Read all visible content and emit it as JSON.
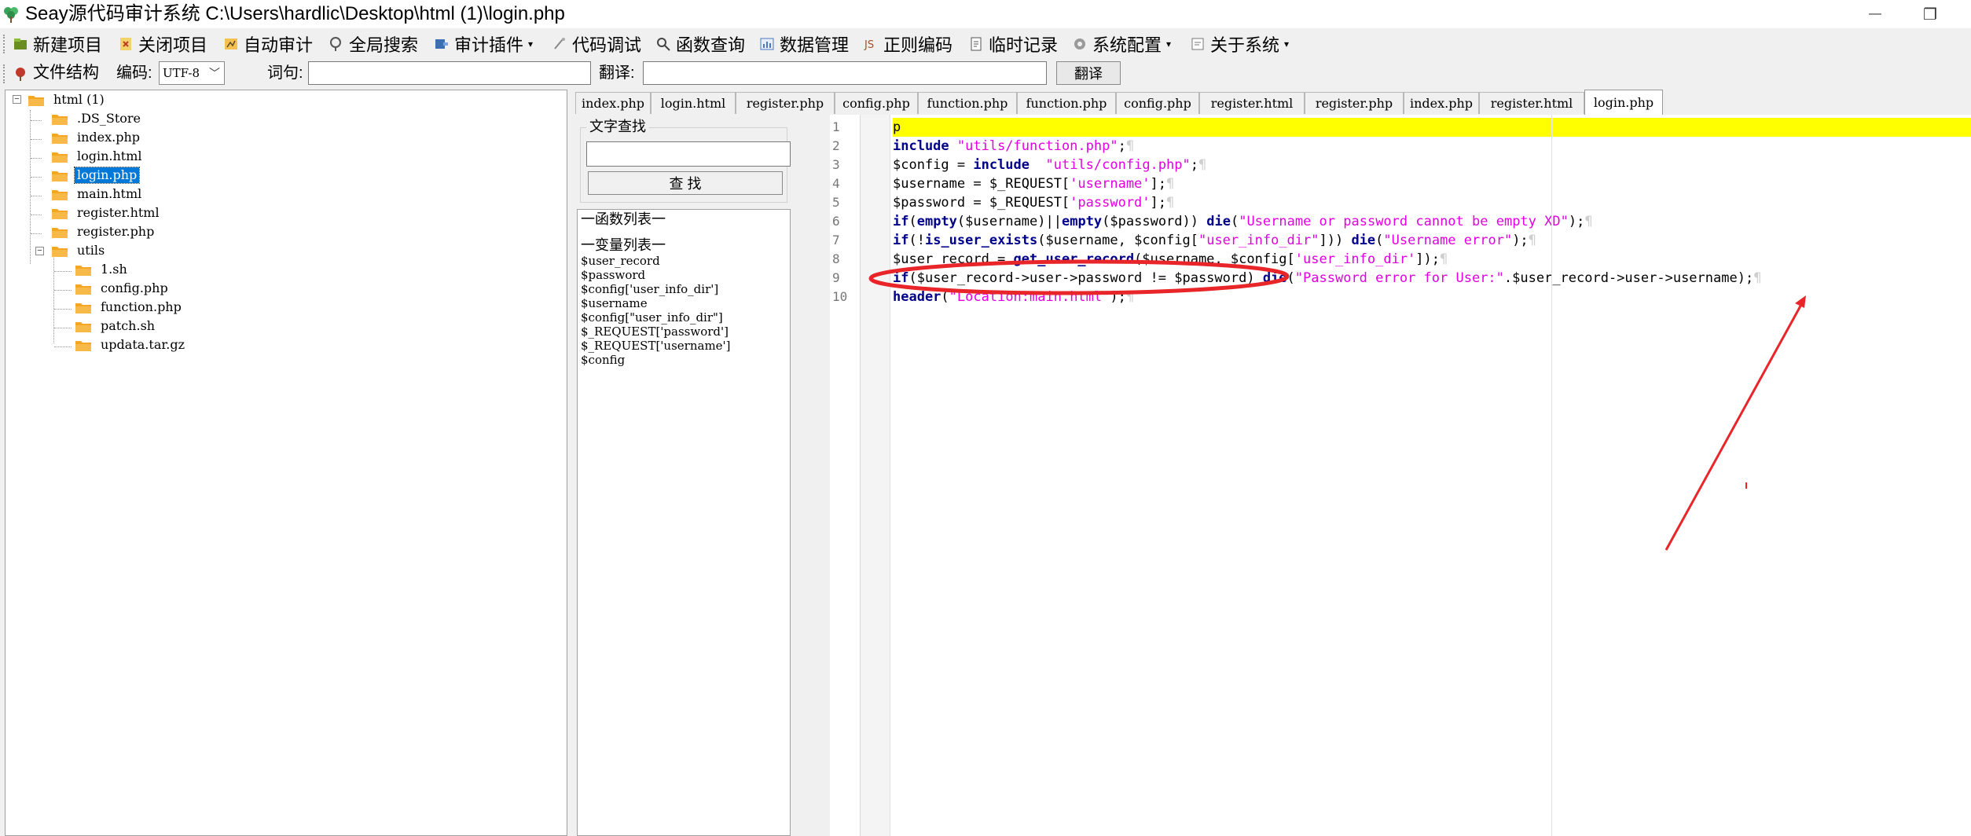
{
  "window": {
    "title": "Seay源代码审计系统  C:\\Users\\hardlic\\Desktop\\html (1)\\login.php",
    "minimize_glyph": "—",
    "restore_glyph": "❐"
  },
  "menubar": {
    "items": [
      {
        "label": "新建项目",
        "icon": "new-project-icon"
      },
      {
        "label": "关闭项目",
        "icon": "close-project-icon"
      },
      {
        "label": "自动审计",
        "icon": "auto-audit-icon"
      },
      {
        "label": "全局搜索",
        "icon": "global-search-icon"
      },
      {
        "label": "审计插件",
        "icon": "plugin-icon",
        "dropdown": true
      },
      {
        "label": "代码调试",
        "icon": "debug-icon"
      },
      {
        "label": "函数查询",
        "icon": "function-query-icon"
      },
      {
        "label": "数据管理",
        "icon": "data-manage-icon"
      },
      {
        "label": "正则编码",
        "icon": "regex-encode-icon"
      },
      {
        "label": "临时记录",
        "icon": "temp-record-icon"
      },
      {
        "label": "系统配置",
        "icon": "gear-icon",
        "dropdown": true
      },
      {
        "label": "关于系统",
        "icon": "about-icon",
        "dropdown": true
      }
    ],
    "dropdown_glyph": "▾"
  },
  "toolbar": {
    "file_structure_label": "文件结构",
    "encoding_label": "编码:",
    "encoding_value": "UTF-8",
    "word_label": "词句:",
    "word_value": "",
    "translate_label": "翻译:",
    "translate_value": "",
    "translate_button": "翻译"
  },
  "tree": {
    "root": "html (1)",
    "items": [
      ".DS_Store",
      "index.php",
      "login.html",
      "login.php",
      "main.html",
      "register.html",
      "register.php"
    ],
    "selected": "login.php",
    "subfolder": "utils",
    "subitems": [
      "1.sh",
      "config.php",
      "function.php",
      "patch.sh",
      "updata.tar.gz"
    ]
  },
  "tabs": [
    "index.php",
    "login.html",
    "register.php",
    "config.php",
    "function.php",
    "function.php",
    "config.php",
    "register.html",
    "register.php",
    "index.php",
    "register.html",
    "login.php"
  ],
  "active_tab": "login.php",
  "search": {
    "title": "文字查找",
    "input_value": "",
    "button": "查 找"
  },
  "lists": {
    "functions_header": "一函数列表一",
    "variables_header": "一变量列表一",
    "variables": [
      "$user_record",
      "$password",
      "$config['user_info_dir']",
      "$username",
      "$config[\"user_info_dir\"]",
      "$_REQUEST['password']",
      "$_REQUEST['username']",
      "$config"
    ]
  },
  "editor": {
    "line_numbers": [
      "1",
      "2",
      "3",
      "4",
      "5",
      "6",
      "7",
      "8",
      "9",
      "10"
    ],
    "highlighted_line": 1,
    "code": [
      [
        {
          "t": "p",
          "c": "var"
        }
      ],
      [
        {
          "t": "include ",
          "c": "kw"
        },
        {
          "t": "\"utils/function.php\"",
          "c": "str"
        },
        {
          "t": ";",
          "c": "op"
        },
        {
          "t": "¶",
          "c": "pil"
        }
      ],
      [
        {
          "t": "$config = ",
          "c": "var"
        },
        {
          "t": "include",
          "c": "kw"
        },
        {
          "t": "  ",
          "c": "op"
        },
        {
          "t": "\"utils/config.php\"",
          "c": "str"
        },
        {
          "t": ";",
          "c": "op"
        },
        {
          "t": "¶",
          "c": "pil"
        }
      ],
      [
        {
          "t": "$username = $_REQUEST[",
          "c": "var"
        },
        {
          "t": "'username'",
          "c": "str"
        },
        {
          "t": "];",
          "c": "op"
        },
        {
          "t": "¶",
          "c": "pil"
        }
      ],
      [
        {
          "t": "$password = $_REQUEST[",
          "c": "var"
        },
        {
          "t": "'password'",
          "c": "str"
        },
        {
          "t": "];",
          "c": "op"
        },
        {
          "t": "¶",
          "c": "pil"
        }
      ],
      [
        {
          "t": "if",
          "c": "kw"
        },
        {
          "t": "(",
          "c": "op"
        },
        {
          "t": "empty",
          "c": "kw"
        },
        {
          "t": "($username)||",
          "c": "var"
        },
        {
          "t": "empty",
          "c": "kw"
        },
        {
          "t": "($password)) ",
          "c": "var"
        },
        {
          "t": "die",
          "c": "kw"
        },
        {
          "t": "(",
          "c": "op"
        },
        {
          "t": "\"Username or password cannot be empty XD\"",
          "c": "str"
        },
        {
          "t": ");",
          "c": "op"
        },
        {
          "t": "¶",
          "c": "pil"
        }
      ],
      [
        {
          "t": "if",
          "c": "kw"
        },
        {
          "t": "(!",
          "c": "op"
        },
        {
          "t": "is_user_exists",
          "c": "kw"
        },
        {
          "t": "($username, $config[",
          "c": "var"
        },
        {
          "t": "\"user_info_dir\"",
          "c": "str"
        },
        {
          "t": "])) ",
          "c": "op"
        },
        {
          "t": "die",
          "c": "kw"
        },
        {
          "t": "(",
          "c": "op"
        },
        {
          "t": "\"Username error\"",
          "c": "str"
        },
        {
          "t": ");",
          "c": "op"
        },
        {
          "t": "¶",
          "c": "pil"
        }
      ],
      [
        {
          "t": "$user_record = ",
          "c": "var"
        },
        {
          "t": "get_user_record",
          "c": "kw"
        },
        {
          "t": "($username, $config[",
          "c": "var"
        },
        {
          "t": "'user_info_dir'",
          "c": "str"
        },
        {
          "t": "]);",
          "c": "op"
        },
        {
          "t": "¶",
          "c": "pil"
        }
      ],
      [
        {
          "t": "if",
          "c": "kw"
        },
        {
          "t": "($user_record->user->password != $password) ",
          "c": "var"
        },
        {
          "t": "die",
          "c": "kw"
        },
        {
          "t": "(",
          "c": "op"
        },
        {
          "t": "\"Password error for User:\"",
          "c": "str"
        },
        {
          "t": ".$user_record->user->username);",
          "c": "var"
        },
        {
          "t": "¶",
          "c": "pil"
        }
      ],
      [
        {
          "t": "header",
          "c": "kw"
        },
        {
          "t": "(",
          "c": "op"
        },
        {
          "t": "\"Location:main.html\"",
          "c": "str"
        },
        {
          "t": ");",
          "c": "op"
        },
        {
          "t": "¶",
          "c": "pil"
        }
      ]
    ]
  },
  "colors": {
    "keyword": "#00008b",
    "string": "#e000e0",
    "highlight": "#ffff00",
    "annotation": "#e8262a",
    "selection": "#0078d7"
  }
}
